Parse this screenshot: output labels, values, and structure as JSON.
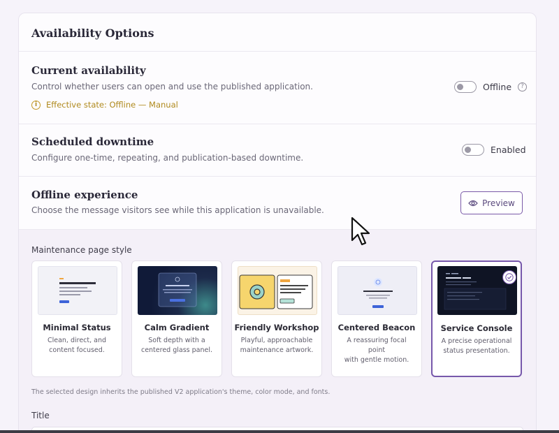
{
  "header": {
    "title": "Availability Options"
  },
  "availability": {
    "title": "Current availability",
    "description": "Control whether users can open and use the published application.",
    "effective_state": "Effective state: Offline — Manual",
    "toggle_label": "Offline",
    "toggle_on": false
  },
  "downtime": {
    "title": "Scheduled downtime",
    "description": "Configure one-time, repeating, and publication-based downtime.",
    "toggle_label": "Enabled",
    "toggle_on": false
  },
  "offline": {
    "title": "Offline experience",
    "description": "Choose the message visitors see while this application is unavailable.",
    "preview_label": "Preview"
  },
  "maintenance": {
    "label": "Maintenance page style",
    "styles": [
      {
        "name": "Minimal Status",
        "desc1": "Clean, direct, and",
        "desc2": "content focused.",
        "selected": false
      },
      {
        "name": "Calm Gradient",
        "desc1": "Soft depth with a",
        "desc2": "centered glass panel.",
        "selected": false
      },
      {
        "name": "Friendly Workshop",
        "desc1": "Playful, approachable",
        "desc2": "maintenance artwork.",
        "selected": false
      },
      {
        "name": "Centered Beacon",
        "desc1": "A reassuring focal point",
        "desc2": "with gentle motion.",
        "selected": false
      },
      {
        "name": "Service Console",
        "desc1": "A precise operational",
        "desc2": "status presentation.",
        "selected": true
      }
    ],
    "note": "The selected design inherits the published V2 application's theme, color mode, and fonts."
  },
  "title_field": {
    "label": "Title",
    "value": ""
  },
  "colors": {
    "accent": "#7758ab",
    "warning": "#b08a1d",
    "background": "#f6f3fa"
  }
}
